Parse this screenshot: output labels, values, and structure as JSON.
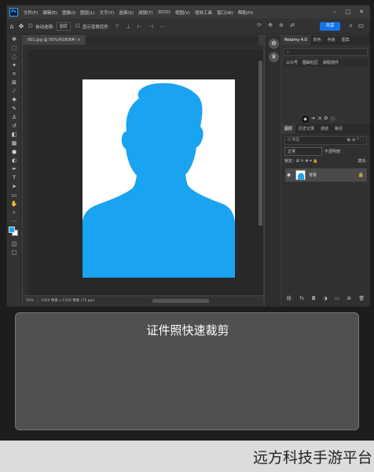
{
  "app": {
    "logo": "Ps"
  },
  "menubar": {
    "items": [
      "文件(F)",
      "编辑(E)",
      "图像(I)",
      "图层(L)",
      "文字(Y)",
      "选择(S)",
      "滤镜(T)",
      "3D(D)",
      "视图(V)",
      "增效工具",
      "窗口(W)",
      "帮助(H)"
    ]
  },
  "options": {
    "auto_select_label": "自动选择:",
    "auto_select_value": "图层",
    "transform_label": "显示变换控件",
    "share_label": "共享"
  },
  "document": {
    "tab_title": "001.jpg @ 50%(RGB/8#)",
    "zoom": "50%",
    "dimensions": "1050 像素 x 1350 像素 (72 ppi)"
  },
  "panels": {
    "top_tabs": [
      "Retamy 4.0",
      "颜色",
      "色板",
      "图案"
    ],
    "quick_tabs": [
      "公众号",
      "图曲社区",
      "获取插件"
    ],
    "layer_tabs": [
      "图层",
      "历史记录",
      "通道",
      "路径"
    ],
    "search_placeholder": "Q 类型",
    "blend_mode": "正常",
    "opacity_label": "不透明度:",
    "lock_label": "锁定:",
    "fill_label": "填充:",
    "layer_name": "背景"
  },
  "banner": {
    "title": "证件照快速裁剪"
  },
  "footer": {
    "watermark": "远方科技手游平台"
  },
  "colors": {
    "accent": "#1473e6",
    "silhouette": "#1aa3f0",
    "foreground": "#1aa3f0",
    "background": "#ffffff"
  }
}
